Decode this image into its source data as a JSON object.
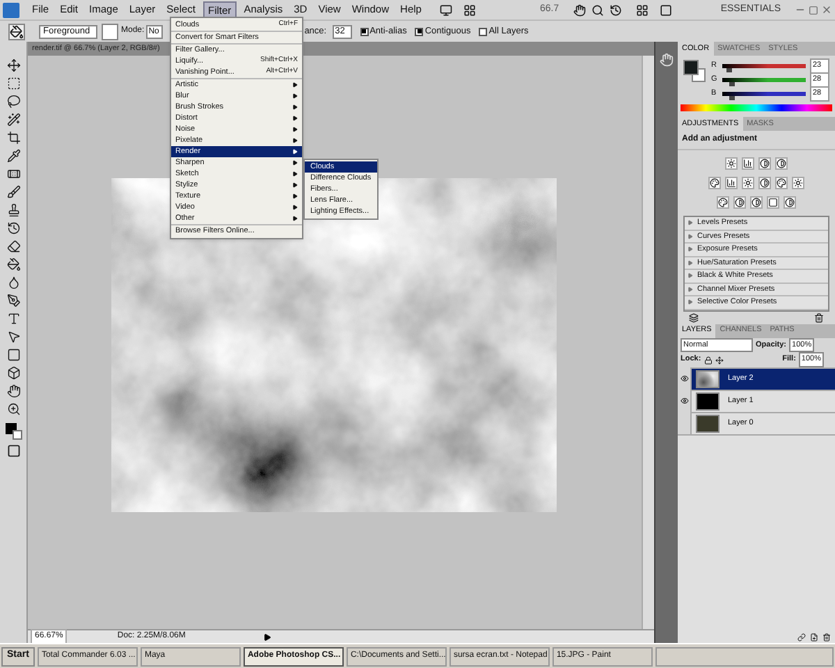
{
  "menu_bar": {
    "items": [
      {
        "label": "File",
        "selected": false
      },
      {
        "label": "Edit",
        "selected": false
      },
      {
        "label": "Image",
        "selected": false
      },
      {
        "label": "Layer",
        "selected": false
      },
      {
        "label": "Select",
        "selected": false
      },
      {
        "label": "Filter",
        "selected": true
      },
      {
        "label": "Analysis",
        "selected": false
      },
      {
        "label": "3D",
        "selected": false
      },
      {
        "label": "View",
        "selected": false
      },
      {
        "label": "Window",
        "selected": false
      },
      {
        "label": "Help",
        "selected": false
      }
    ],
    "zoom": "66.7",
    "workspace": "ESSENTIALS"
  },
  "options_bar": {
    "fill_source": "Foreground",
    "mode_label": "Mode:",
    "mode_value": "No",
    "tolerance_label": "ance:",
    "tolerance": "32",
    "checkboxes": [
      {
        "label": "Anti-alias",
        "checked": true
      },
      {
        "label": "Contiguous",
        "checked": true
      },
      {
        "label": "All Layers",
        "checked": false
      }
    ]
  },
  "document_tab": {
    "title": "render.tif @ 66.7% (Layer 2, RGB/8#)"
  },
  "filter_menu": {
    "groups": [
      [
        {
          "label": "Clouds",
          "shortcut": "Ctrl+F",
          "kind": "command",
          "selected": false
        }
      ],
      [
        {
          "label": "Convert for Smart Filters",
          "kind": "command",
          "selected": false
        }
      ],
      [
        {
          "label": "Filter Gallery...",
          "kind": "command",
          "selected": false
        },
        {
          "label": "Liquify...",
          "shortcut": "Shift+Ctrl+X",
          "kind": "command",
          "selected": false
        },
        {
          "label": "Vanishing Point...",
          "shortcut": "Alt+Ctrl+V",
          "kind": "command",
          "selected": false
        }
      ],
      [
        {
          "label": "Artistic",
          "kind": "submenu",
          "selected": false
        },
        {
          "label": "Blur",
          "kind": "submenu",
          "selected": false
        },
        {
          "label": "Brush Strokes",
          "kind": "submenu",
          "selected": false
        },
        {
          "label": "Distort",
          "kind": "submenu",
          "selected": false
        },
        {
          "label": "Noise",
          "kind": "submenu",
          "selected": false
        },
        {
          "label": "Pixelate",
          "kind": "submenu",
          "selected": false
        },
        {
          "label": "Render",
          "kind": "submenu",
          "selected": true
        },
        {
          "label": "Sharpen",
          "kind": "submenu",
          "selected": false
        },
        {
          "label": "Sketch",
          "kind": "submenu",
          "selected": false
        },
        {
          "label": "Stylize",
          "kind": "submenu",
          "selected": false
        },
        {
          "label": "Texture",
          "kind": "submenu",
          "selected": false
        },
        {
          "label": "Video",
          "kind": "submenu",
          "selected": false
        },
        {
          "label": "Other",
          "kind": "submenu",
          "selected": false
        }
      ],
      [
        {
          "label": "Browse Filters Online...",
          "kind": "command",
          "selected": false
        }
      ]
    ]
  },
  "render_submenu": {
    "items": [
      {
        "label": "Clouds",
        "selected": true
      },
      {
        "label": "Difference Clouds",
        "selected": false
      },
      {
        "label": "Fibers...",
        "selected": false
      },
      {
        "label": "Lens Flare...",
        "selected": false
      },
      {
        "label": "Lighting Effects...",
        "selected": false
      }
    ]
  },
  "color_panel": {
    "tabs": [
      {
        "label": "COLOR",
        "selected": true
      },
      {
        "label": "SWATCHES",
        "selected": false
      },
      {
        "label": "STYLES",
        "selected": false
      }
    ],
    "channels": [
      {
        "name": "R",
        "value": "23",
        "level": 0.09,
        "color": "#c83030"
      },
      {
        "name": "G",
        "value": "28",
        "level": 0.11,
        "color": "#30b030"
      },
      {
        "name": "B",
        "value": "28",
        "level": 0.11,
        "color": "#3030c0"
      }
    ]
  },
  "adjustments_panel": {
    "tabs": [
      {
        "label": "ADJUSTMENTS",
        "selected": true
      },
      {
        "label": "MASKS",
        "selected": false
      }
    ],
    "heading": "Add an adjustment",
    "presets": [
      "Levels Presets",
      "Curves Presets",
      "Exposure Presets",
      "Hue/Saturation Presets",
      "Black & White Presets",
      "Channel Mixer Presets",
      "Selective Color Presets"
    ]
  },
  "layers_panel": {
    "tabs": [
      {
        "label": "LAYERS",
        "selected": true
      },
      {
        "label": "CHANNELS",
        "selected": false
      },
      {
        "label": "PATHS",
        "selected": false
      }
    ],
    "blend_mode": "Normal",
    "opacity_label": "Opacity:",
    "opacity": "100%",
    "lock_label": "Lock:",
    "fill_label": "Fill:",
    "fill": "100%",
    "layers": [
      {
        "name": "Layer 2",
        "selected": true,
        "visible": true,
        "kind": "clouds"
      },
      {
        "name": "Layer 1",
        "selected": false,
        "visible": true,
        "kind": "black"
      },
      {
        "name": "Layer 0",
        "selected": false,
        "visible": false,
        "kind": "photo"
      }
    ]
  },
  "status_bar": {
    "zoom": "66.67%",
    "doc": "Doc: 2.25M/8.06M"
  },
  "taskbar": {
    "start": "Start",
    "tasks": [
      {
        "label": "Total Commander 6.03 ...",
        "selected": false
      },
      {
        "label": "Maya",
        "selected": false
      },
      {
        "label": "Adobe Photoshop CS...",
        "selected": true
      },
      {
        "label": "C:\\Documents and Setti...",
        "selected": false
      },
      {
        "label": "sursa ecran.txt - Notepad",
        "selected": false
      },
      {
        "label": "15.JPG - Paint",
        "selected": false
      }
    ]
  }
}
